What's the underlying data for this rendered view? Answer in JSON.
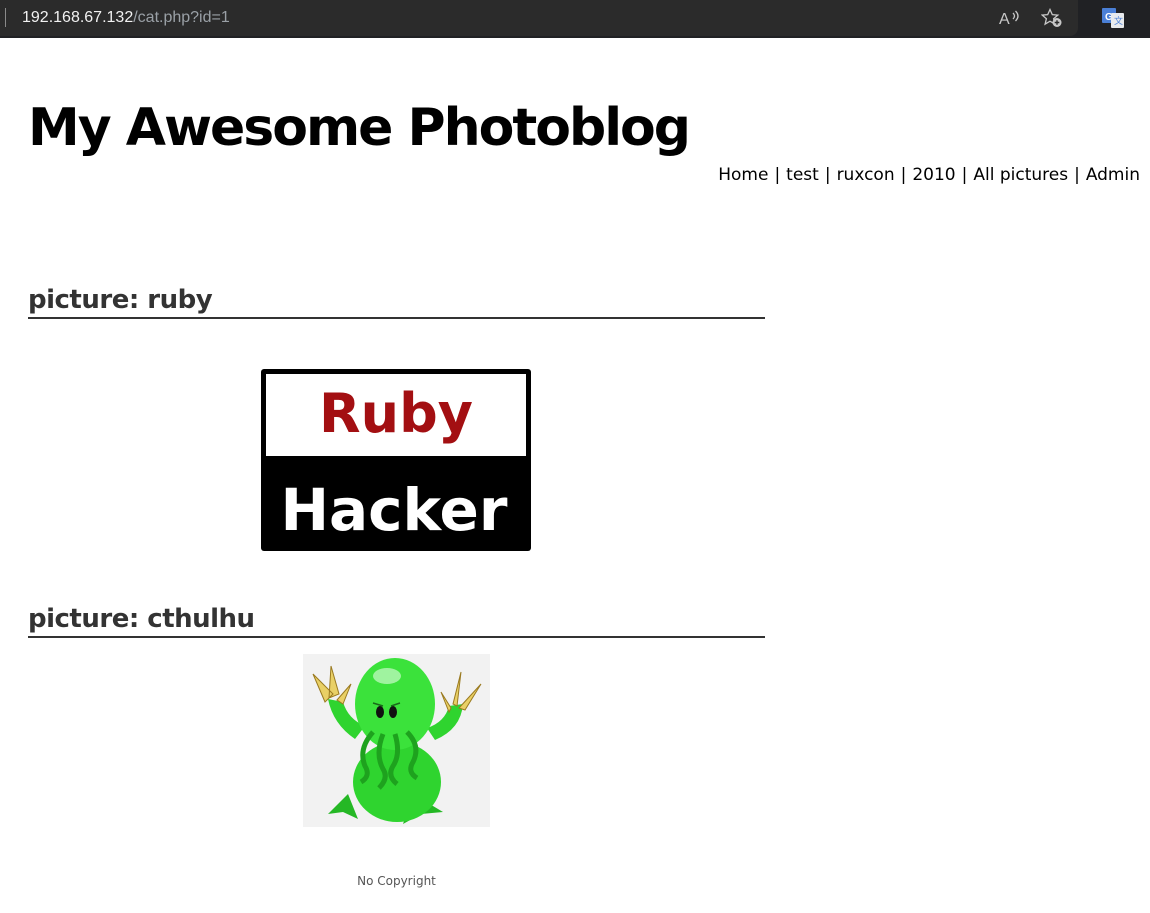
{
  "browser": {
    "url_host": "192.168.67.132",
    "url_path": "/cat.php?id=1",
    "icons": [
      "read-aloud-icon",
      "add-favorite-icon",
      "translate-icon"
    ]
  },
  "site": {
    "title": "My Awesome Photoblog"
  },
  "nav": {
    "separator": "|",
    "items": [
      {
        "label": "Home"
      },
      {
        "label": "test"
      },
      {
        "label": "ruxcon"
      },
      {
        "label": "2010"
      },
      {
        "label": "All pictures"
      },
      {
        "label": "Admin"
      }
    ]
  },
  "pictures": [
    {
      "heading": "picture: ruby",
      "image_text_top": "Ruby",
      "image_text_bottom": "Hacker"
    },
    {
      "heading": "picture: cthulhu"
    }
  ],
  "footer": {
    "text": "No Copyright"
  },
  "colors": {
    "browser_bar": "#202124",
    "ruby_red": "#a30f12",
    "cthulhu_green": "#2fd42f"
  }
}
